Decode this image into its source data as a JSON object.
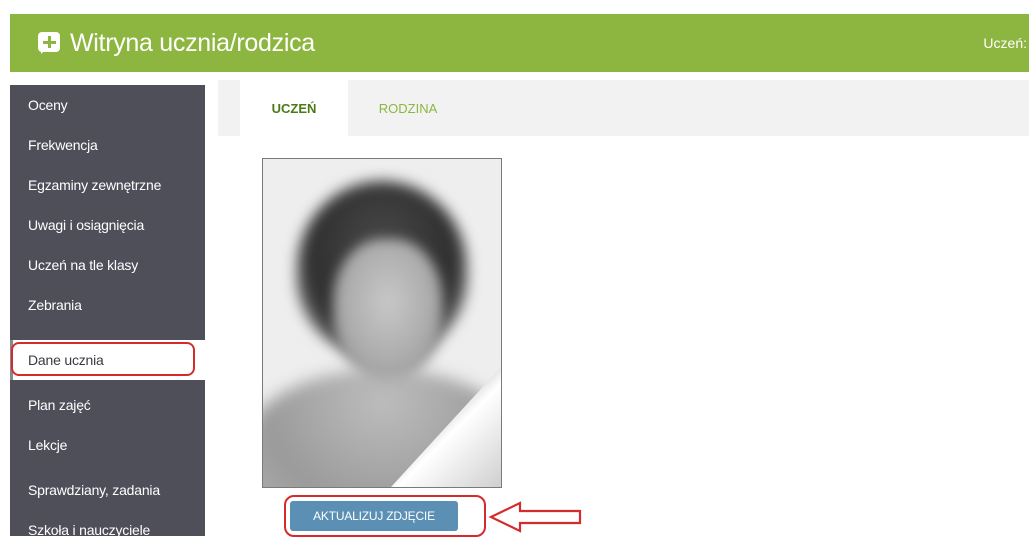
{
  "header": {
    "app_title": "Witryna ucznia/rodzica",
    "user_label": "Uczeń:",
    "accent_color": "#8db640"
  },
  "sidebar": {
    "items": [
      {
        "label": "Oceny"
      },
      {
        "label": "Frekwencja"
      },
      {
        "label": "Egzaminy zewnętrzne"
      },
      {
        "label": "Uwagi i osiągnięcia"
      },
      {
        "label": "Uczeń na tle klasy"
      },
      {
        "label": "Zebrania"
      },
      {
        "label": "Dane ucznia",
        "active": true
      },
      {
        "label": "Plan zajęć"
      },
      {
        "label": "Lekcje"
      },
      {
        "label": "Sprawdziany, zadania"
      },
      {
        "label": "Szkoła i nauczyciele"
      }
    ]
  },
  "tabs": [
    {
      "label": "UCZEŃ",
      "active": true
    },
    {
      "label": "RODZINA",
      "active": false
    }
  ],
  "photo": {
    "update_button_label": "AKTUALIZUJ ZDJĘCIE"
  },
  "annotations": {
    "highlight_color": "#d42c2c"
  }
}
